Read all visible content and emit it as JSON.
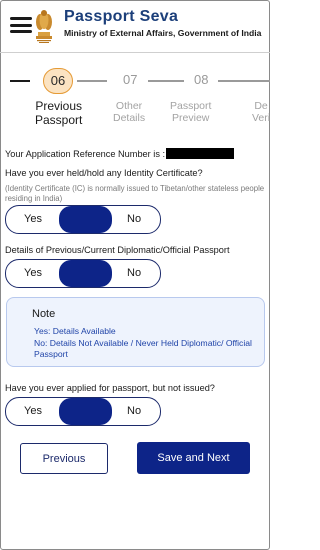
{
  "header": {
    "title": "Passport Seva",
    "subtitle": "Ministry of External Affairs, Government of India"
  },
  "stepper": {
    "steps": [
      {
        "num": "06",
        "label_line1": "Previous",
        "label_line2": "Passport",
        "active": true
      },
      {
        "num": "07",
        "label_line1": "Other",
        "label_line2": "Details",
        "active": false
      },
      {
        "num": "08",
        "label_line1": "Passport",
        "label_line2": "Preview",
        "active": false
      },
      {
        "num": "",
        "label_line1": "De",
        "label_line2": "Veri",
        "active": false
      }
    ]
  },
  "reference": {
    "label": "Your Application Reference Number is :"
  },
  "identity_certificate": {
    "question": "Have you ever held/hold any Identity Certificate?",
    "hint": "(Identity Certificate (IC) is normally issued to Tibetan/other stateless people residing in India)",
    "yes_label": "Yes",
    "no_label": "No"
  },
  "diplomatic_passport": {
    "question": "Details of Previous/Current Diplomatic/Official Passport",
    "yes_label": "Yes",
    "no_label": "No"
  },
  "note": {
    "title": "Note",
    "yes_text": "Yes: Details Available",
    "no_text": "No: Details Not Available / Never Held Diplomatic/ Official Passport"
  },
  "applied_not_issued": {
    "question": "Have you ever applied for passport, but not issued?",
    "yes_label": "Yes",
    "no_label": "No"
  },
  "actions": {
    "previous_label": "Previous",
    "next_label": "Save and Next"
  },
  "colors": {
    "brand_blue": "#1c3f7a",
    "primary": "#0d2488",
    "active_step_fill": "#fbe3c2",
    "active_step_border": "#e59a35",
    "note_bg": "#eef3fd",
    "note_text": "#2044a8"
  },
  "icons": [
    "hamburger-menu-icon",
    "national-emblem-logo"
  ]
}
